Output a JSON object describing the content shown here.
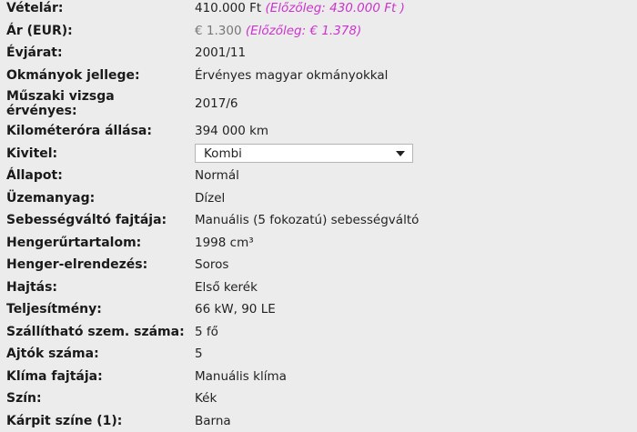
{
  "specs": {
    "price_huf": {
      "label": "Vételár:",
      "value": "410.000 Ft",
      "previous": "(Előzőleg: 430.000 Ft )"
    },
    "price_eur": {
      "label": "Ár (EUR):",
      "value": "€ 1.300",
      "previous": "(Előzőleg: € 1.378)"
    },
    "year": {
      "label": "Évjárat:",
      "value": "2001/11"
    },
    "documents": {
      "label": "Okmányok jellege:",
      "value": "Érvényes magyar okmányokkal"
    },
    "inspection": {
      "label_line1": "Műszaki vizsga",
      "label_line2": "érvényes:",
      "value": "2017/6"
    },
    "mileage": {
      "label": "Kilométeróra állása:",
      "value": "394 000 km"
    },
    "body_type": {
      "label": "Kivitel:",
      "selected": "Kombi"
    },
    "condition": {
      "label": "Állapot:",
      "value": "Normál"
    },
    "fuel": {
      "label": "Üzemanyag:",
      "value": "Dízel"
    },
    "transmission": {
      "label": "Sebességváltó fajtája:",
      "value": "Manuális (5 fokozatú) sebességváltó"
    },
    "displacement": {
      "label": "Hengerűrtartalom:",
      "value": "1998 cm³"
    },
    "cylinder_layout": {
      "label": "Henger-elrendezés:",
      "value": "Soros"
    },
    "drive": {
      "label": "Hajtás:",
      "value": "Első kerék"
    },
    "power": {
      "label": "Teljesítmény:",
      "value": "66 kW, 90 LE"
    },
    "seats": {
      "label": "Szállítható szem. száma:",
      "value": "5 fő"
    },
    "doors": {
      "label": "Ajtók száma:",
      "value": "5"
    },
    "ac": {
      "label": "Klíma fajtája:",
      "value": "Manuális klíma"
    },
    "color": {
      "label": "Szín:",
      "value": "Kék"
    },
    "interior_color": {
      "label": "Kárpit színe (1):",
      "value": "Barna"
    }
  },
  "colors": {
    "background": "#ececec",
    "previous_price": "#cc33cc",
    "muted_text": "#777777"
  }
}
